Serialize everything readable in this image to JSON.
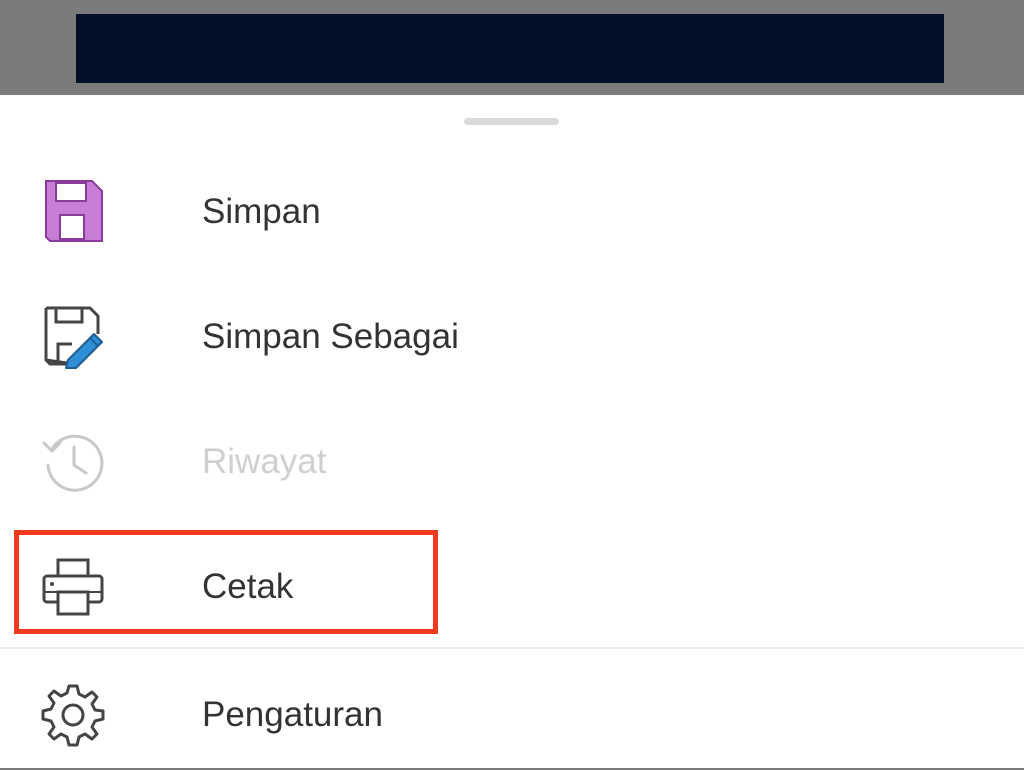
{
  "menu": {
    "items": [
      {
        "label": "Simpan",
        "icon": "save-floppy-icon",
        "enabled": true
      },
      {
        "label": "Simpan Sebagai",
        "icon": "save-as-pencil-icon",
        "enabled": true
      },
      {
        "label": "Riwayat",
        "icon": "history-clock-icon",
        "enabled": false
      },
      {
        "label": "Cetak",
        "icon": "printer-icon",
        "enabled": true,
        "highlighted": true
      },
      {
        "label": "Pengaturan",
        "icon": "gear-icon",
        "enabled": true
      }
    ]
  },
  "colors": {
    "banner": "#011026",
    "scrim": "#7b7b7b",
    "save_icon": "#c77dd6",
    "save_as_pencil": "#2f8ed8",
    "highlight": "#f0391f",
    "text": "#333333",
    "disabled_text": "#cfcfcf"
  }
}
